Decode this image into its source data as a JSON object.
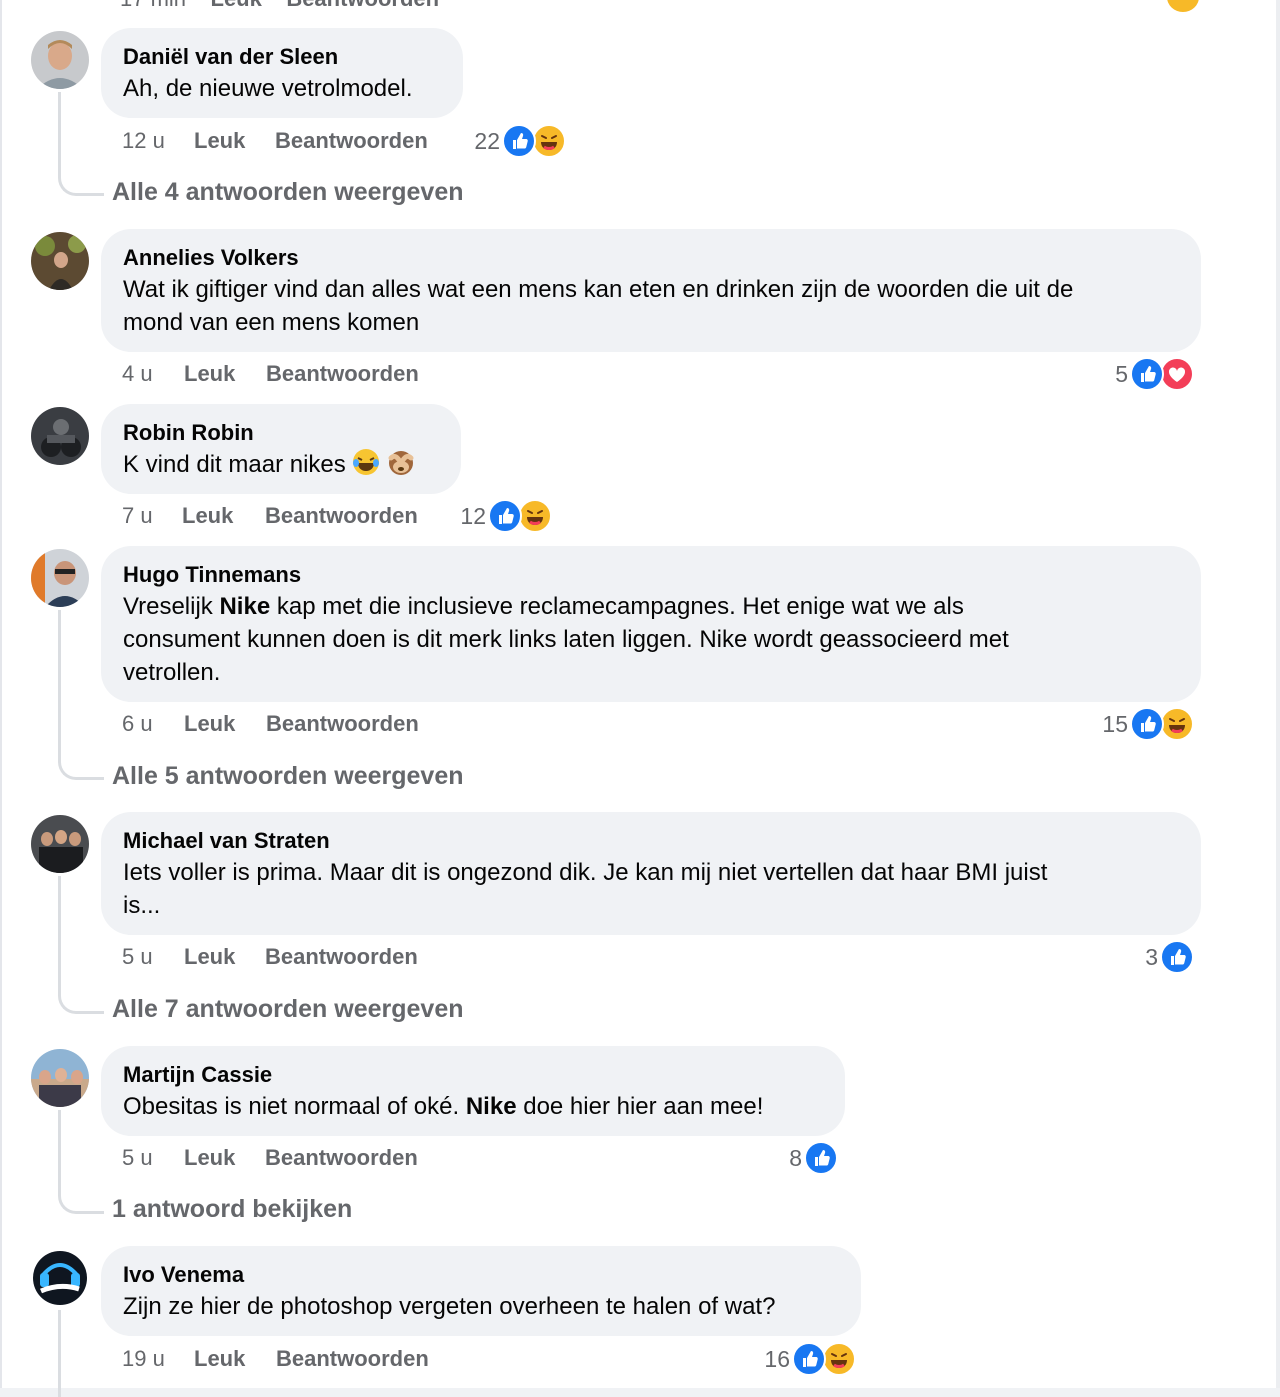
{
  "top_partial": {
    "time": "17 min",
    "like": "Leuk",
    "reply": "Beantwoorden"
  },
  "colors": {
    "like_blue": "#1877f2",
    "love_red": "#f33e58",
    "haha_yellow": "#f7b928",
    "bubble_bg": "#f0f2f5",
    "meta_gray": "#65676b"
  },
  "comments": [
    {
      "author": "Daniël van der Sleen",
      "text": "Ah, de nieuwe vetrolmodel.",
      "time": "12 u",
      "like": "Leuk",
      "reply": "Beantwoorden",
      "reaction_count": "22",
      "reactions": [
        "like-icon",
        "haha-icon"
      ],
      "view_replies": "Alle 4 antwoorden weergeven"
    },
    {
      "author": "Annelies Volkers",
      "text_line1": "Wat ik giftiger vind dan alles wat een mens kan eten en drinken zijn de woorden die uit de",
      "text_line2": "mond van een mens komen",
      "time": "4 u",
      "like": "Leuk",
      "reply": "Beantwoorden",
      "reaction_count": "5",
      "reactions": [
        "like-icon",
        "love-icon"
      ]
    },
    {
      "author": "Robin Robin",
      "text": "K vind dit maar nikes",
      "emojis": [
        "laughing-tears-emoji",
        "see-no-evil-monkey-emoji"
      ],
      "time": "7 u",
      "like": "Leuk",
      "reply": "Beantwoorden",
      "reaction_count": "12",
      "reactions": [
        "like-icon",
        "haha-icon"
      ]
    },
    {
      "author": "Hugo Tinnemans",
      "text_a": "Vreselijk ",
      "text_b": "Nike",
      "text_c": " kap met die inclusieve reclamecampagnes. Het enige wat we als",
      "text_line2": "consument kunnen doen is dit merk links laten liggen. Nike wordt geassocieerd met",
      "text_line3": "vetrollen.",
      "time": "6 u",
      "like": "Leuk",
      "reply": "Beantwoorden",
      "reaction_count": "15",
      "reactions": [
        "like-icon",
        "haha-icon"
      ],
      "view_replies": "Alle 5 antwoorden weergeven"
    },
    {
      "author": "Michael van Straten",
      "text_line1": "Iets voller is prima. Maar dit is ongezond dik. Je kan mij niet vertellen dat haar BMI juist",
      "text_line2": "is...",
      "time": "5 u",
      "like": "Leuk",
      "reply": "Beantwoorden",
      "reaction_count": "3",
      "reactions": [
        "like-icon"
      ],
      "view_replies": "Alle 7 antwoorden weergeven"
    },
    {
      "author": "Martijn Cassie",
      "text_a": "Obesitas is niet normaal of oké. ",
      "text_b": "Nike",
      "text_c": " doe hier hier aan mee!",
      "time": "5 u",
      "like": "Leuk",
      "reply": "Beantwoorden",
      "reaction_count": "8",
      "reactions": [
        "like-icon"
      ],
      "view_replies": "1 antwoord bekijken"
    },
    {
      "author": "Ivo Venema",
      "text": "Zijn ze hier de photoshop vergeten overheen te halen of wat?",
      "time": "19 u",
      "like": "Leuk",
      "reply": "Beantwoorden",
      "reaction_count": "16",
      "reactions": [
        "like-icon",
        "haha-icon"
      ]
    }
  ]
}
